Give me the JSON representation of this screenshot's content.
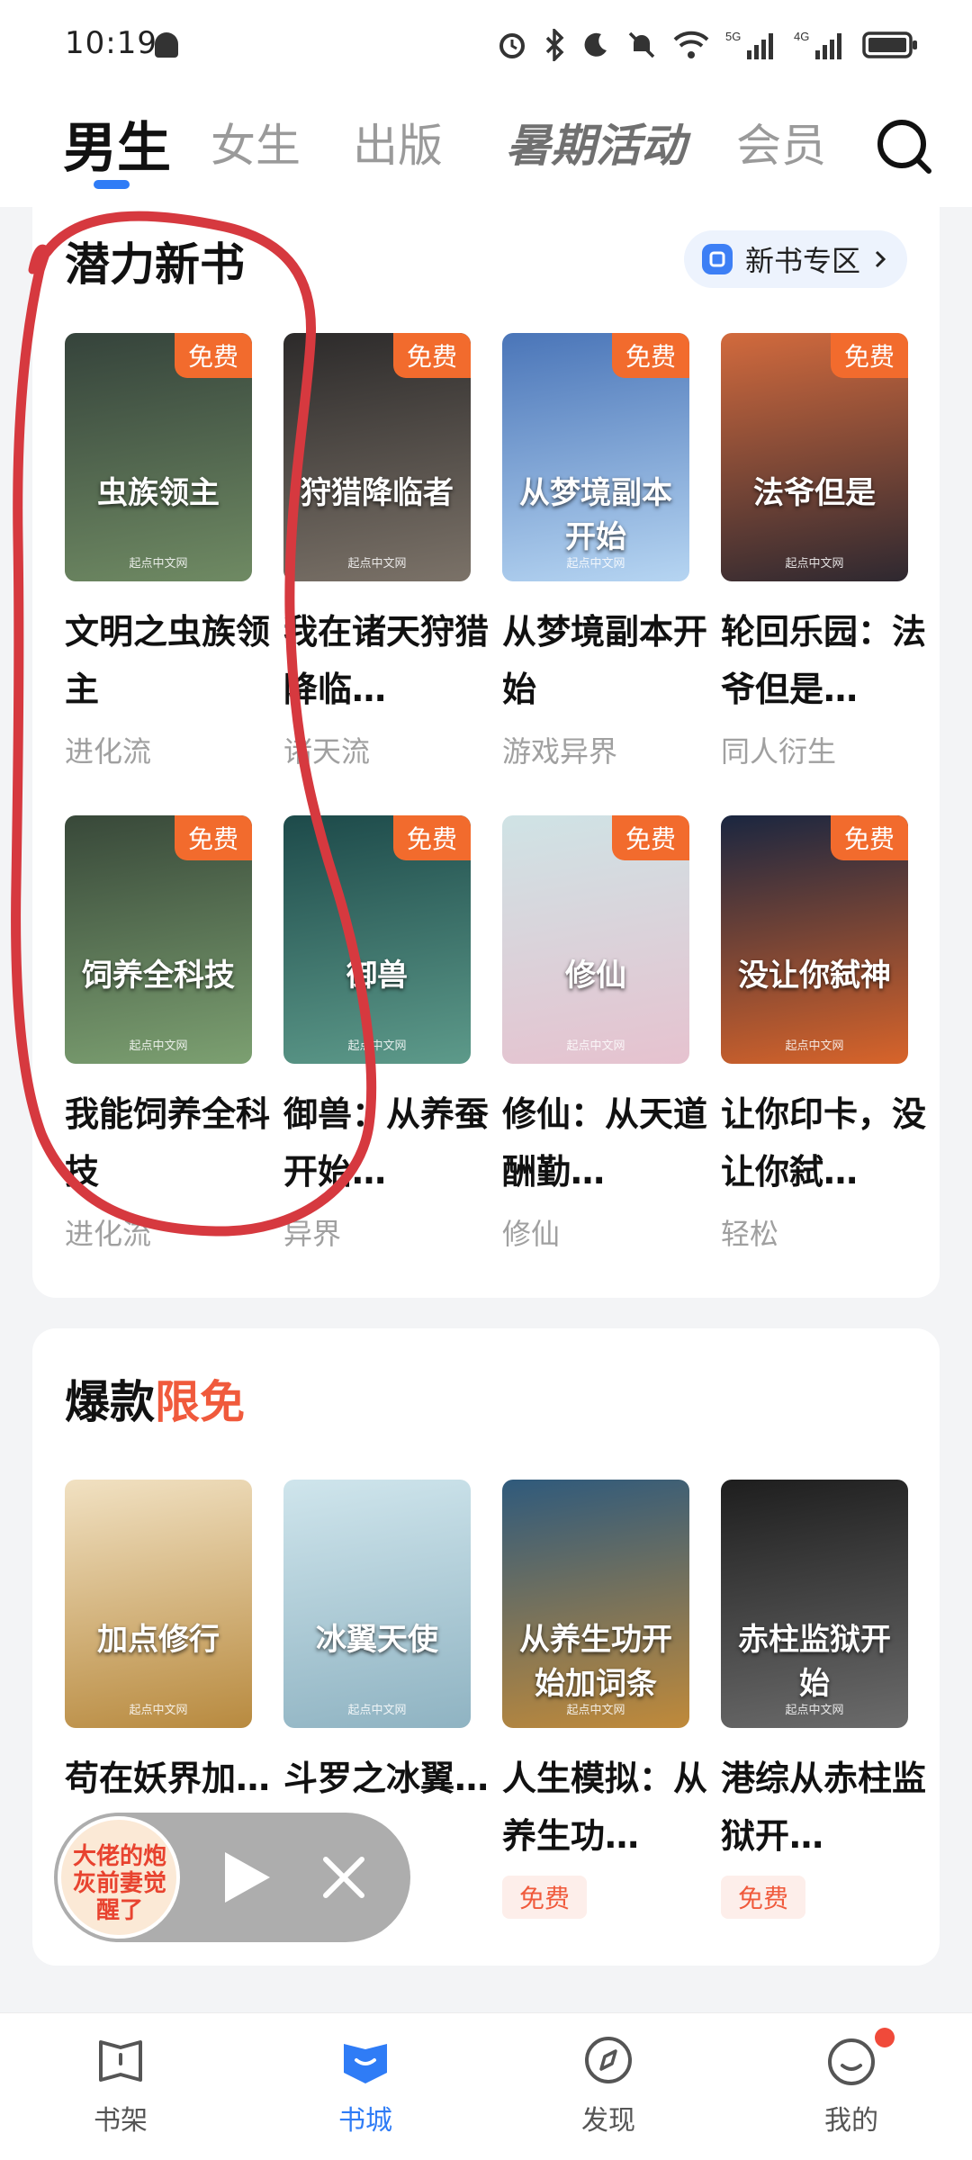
{
  "status_bar": {
    "time": "10:19",
    "network_1": "5G",
    "network_2": "4G"
  },
  "top_tabs": [
    {
      "label": "男生",
      "active": true
    },
    {
      "label": "女生",
      "active": false
    },
    {
      "label": "出版",
      "active": false
    },
    {
      "label": "暑期活动",
      "active": false
    },
    {
      "label": "会员",
      "active": false
    }
  ],
  "section_new": {
    "title": "潜力新书",
    "zone_button": "新书专区"
  },
  "new_books": [
    {
      "cover_title": "虫族领主",
      "free": "免费",
      "name": "文明之虫族领主",
      "genre": "进化流",
      "brand": "起点中文网",
      "colors": [
        "#35433b",
        "#6f8a63"
      ]
    },
    {
      "cover_title": "狩猎降临者",
      "free": "免费",
      "name": "我在诸天狩猎降临…",
      "genre": "诸天流",
      "brand": "起点中文网",
      "colors": [
        "#2c2a2a",
        "#7b7268"
      ]
    },
    {
      "cover_title": "从梦境副本开始",
      "free": "免费",
      "name": "从梦境副本开始",
      "genre": "游戏异界",
      "brand": "起点中文网",
      "colors": [
        "#4a75b8",
        "#b6d5f2"
      ]
    },
    {
      "cover_title": "法爷但是",
      "free": "免费",
      "name": "轮回乐园：法爷但是…",
      "genre": "同人衍生",
      "brand": "起点中文网",
      "colors": [
        "#d26a3d",
        "#2e2830"
      ]
    },
    {
      "cover_title": "饲养全科技",
      "free": "免费",
      "name": "我能饲养全科技",
      "genre": "进化流",
      "brand": "起点中文网",
      "colors": [
        "#384839",
        "#7ca071"
      ]
    },
    {
      "cover_title": "御兽",
      "free": "免费",
      "name": "御兽：从养蚕开始…",
      "genre": "异界",
      "brand": "起点中文网",
      "colors": [
        "#1d4a4a",
        "#5d9a8a"
      ]
    },
    {
      "cover_title": "修仙",
      "free": "免费",
      "name": "修仙：从天道酬勤…",
      "genre": "修仙",
      "brand": "起点中文网",
      "colors": [
        "#cfe3e5",
        "#e6c2cf"
      ]
    },
    {
      "cover_title": "没让你弑神",
      "free": "免费",
      "name": "让你印卡，没让你弑…",
      "genre": "轻松",
      "brand": "起点中文网",
      "colors": [
        "#1a2640",
        "#d8642a"
      ]
    }
  ],
  "section_hot": {
    "title_main": "爆款",
    "title_accent": "限免"
  },
  "hot_books": [
    {
      "cover_title": "加点修行",
      "name": "苟在妖界加…",
      "brand": "起点中文网",
      "colors": [
        "#f1e1c2",
        "#b88a3f"
      ],
      "free": ""
    },
    {
      "cover_title": "冰翼天使",
      "name": "斗罗之冰翼…",
      "brand": "起点中文网",
      "colors": [
        "#cfe5ec",
        "#8fb3c2"
      ],
      "free": ""
    },
    {
      "cover_title": "从养生功开始加词条",
      "name": "人生模拟：从养生功…",
      "brand": "起点中文网",
      "colors": [
        "#2f5a7c",
        "#c08a3a"
      ],
      "free": "免费"
    },
    {
      "cover_title": "赤柱监狱开始",
      "name": "港综从赤柱监狱开…",
      "brand": "起点中文网",
      "colors": [
        "#1e1e1e",
        "#6b6b6b"
      ],
      "free": "免费"
    }
  ],
  "float_player": {
    "cover_text": "大佬的炮灰前妻觉醒了"
  },
  "bottom_nav": [
    {
      "label": "书架",
      "icon": "bookshelf-icon",
      "active": false
    },
    {
      "label": "书城",
      "icon": "bookstore-icon",
      "active": true
    },
    {
      "label": "发现",
      "icon": "compass-icon",
      "active": false
    },
    {
      "label": "我的",
      "icon": "profile-icon",
      "active": false
    }
  ],
  "colors": {
    "accent_blue": "#2f7cf6",
    "free_orange": "#f26b2d",
    "accent_red": "#f05a3c",
    "annotation_red": "#d6393f"
  }
}
